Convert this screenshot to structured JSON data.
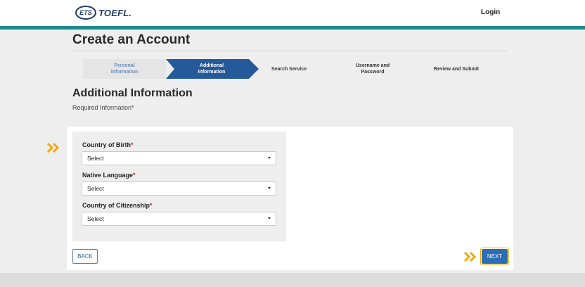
{
  "header": {
    "logo_ets": "ETS",
    "logo_product": "TOEFL.",
    "login_label": "Login"
  },
  "page": {
    "title": "Create an Account",
    "section_title": "Additional Information",
    "required_note": "Required Information*"
  },
  "stepper": {
    "steps": [
      {
        "line1": "Personal",
        "line2": "Information",
        "state": "done"
      },
      {
        "line1": "Additional",
        "line2": "Information",
        "state": "active"
      },
      {
        "line1": "Search Service",
        "line2": "",
        "state": "pending"
      },
      {
        "line1": "Username and",
        "line2": "Password",
        "state": "pending"
      },
      {
        "line1": "Review and Submit",
        "line2": "",
        "state": "pending"
      }
    ]
  },
  "form": {
    "fields": [
      {
        "label": "Country of Birth",
        "required_mark": "*",
        "value": "Select"
      },
      {
        "label": "Native Language",
        "required_mark": "*",
        "value": "Select"
      },
      {
        "label": "Country of Citizenship",
        "required_mark": "*",
        "value": "Select"
      }
    ]
  },
  "actions": {
    "back_label": "BACK",
    "next_label": "NEXT"
  },
  "icons": {
    "pointer": "double-chevron-right-icon",
    "pointer_color": "#f2a700",
    "accent": "#1d8a8c",
    "primary": "#2d6db5",
    "stepper_active": "#245a9a"
  }
}
